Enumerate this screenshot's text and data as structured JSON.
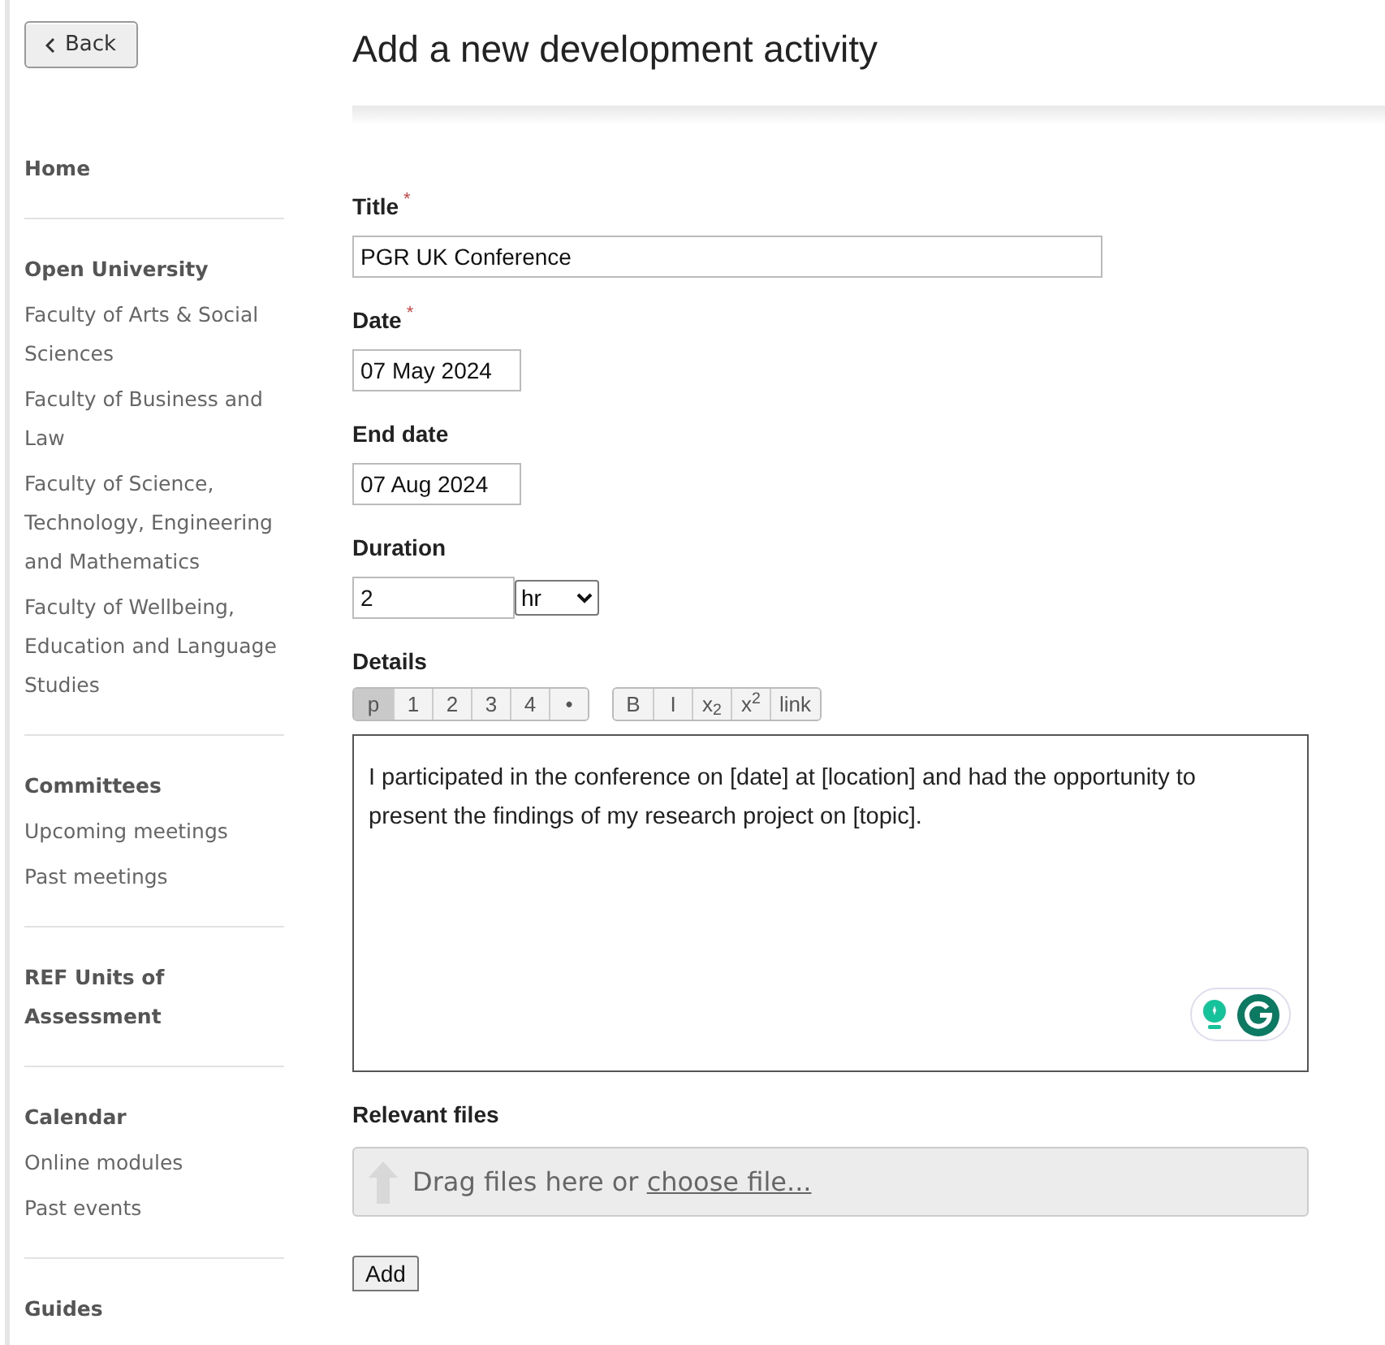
{
  "back_button": {
    "label": "Back"
  },
  "sidebar": {
    "sections": [
      {
        "heading": "Home"
      },
      {
        "heading": "Open University",
        "items": [
          "Faculty of Arts & Social Sciences",
          "Faculty of Business and Law",
          "Faculty of Science, Technology, Engineering and Mathematics",
          "Faculty of Wellbeing, Education and Language Studies"
        ]
      },
      {
        "heading": "Committees",
        "items": [
          "Upcoming meetings",
          "Past meetings"
        ]
      },
      {
        "heading": "REF Units of Assessment"
      },
      {
        "heading": "Calendar",
        "items": [
          "Online modules",
          "Past events"
        ]
      },
      {
        "heading": "Guides"
      }
    ]
  },
  "page_title": "Add a new development activity",
  "required_mark": "*",
  "fields": [
    {
      "kind": "text",
      "label": "Title",
      "required": true,
      "value": "PGR UK Conference"
    },
    {
      "kind": "date",
      "label": "Date",
      "required": true,
      "value": "07 May 2024"
    },
    {
      "kind": "date",
      "label": "End date",
      "required": false,
      "value": "07 Aug 2024"
    },
    {
      "kind": "duration",
      "label": "Duration",
      "required": false,
      "value": "2",
      "unit": "hr"
    }
  ],
  "details": {
    "label": "Details",
    "toolbar": [
      [
        {
          "label": "p",
          "selected": true
        },
        {
          "label": "1",
          "selected": false
        },
        {
          "label": "2",
          "selected": false
        },
        {
          "label": "3",
          "selected": false
        },
        {
          "label": "4",
          "selected": false
        },
        {
          "label": "•",
          "selected": false
        }
      ],
      [
        {
          "label": "B",
          "selected": false
        },
        {
          "label": "I",
          "selected": false
        },
        {
          "label": "x$_{2}$",
          "selected": false
        },
        {
          "label": "x$^{2}$",
          "selected": false
        },
        {
          "label": "link",
          "selected": false
        }
      ]
    ],
    "text": "I participated in the conference on [date] at [location] and had the opportunity to present the findings of my research project on [topic]."
  },
  "files": {
    "label": "Relevant files",
    "prompt": "Drag files here or",
    "link": "choose file..."
  },
  "add_button": {
    "label": "Add"
  }
}
